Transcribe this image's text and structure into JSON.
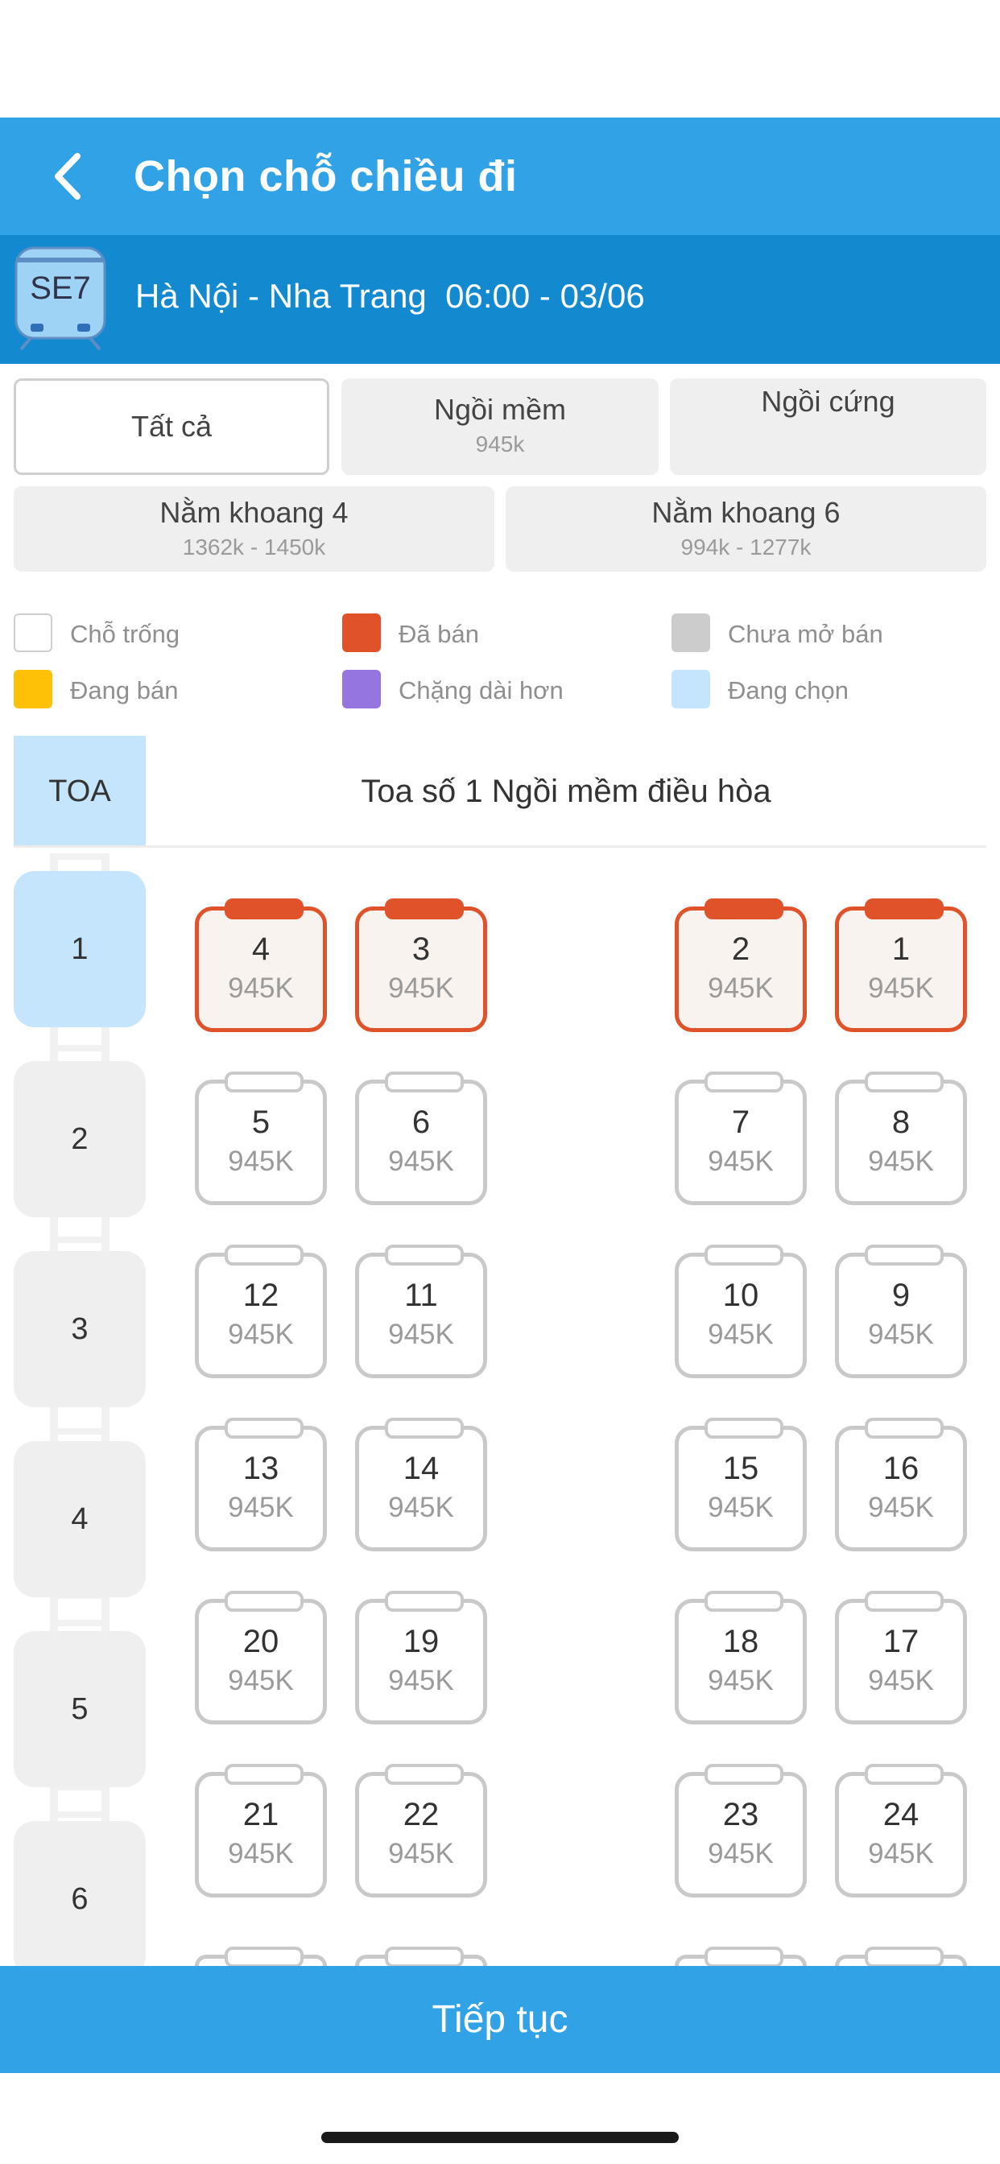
{
  "header": {
    "title": "Chọn chỗ chiều đi"
  },
  "train": {
    "code": "SE7",
    "route": "Hà Nội - Nha Trang  06:00 - 03/06"
  },
  "filters": [
    {
      "label": "Tất cả",
      "price": "",
      "active": true
    },
    {
      "label": "Ngồi mềm",
      "price": "945k",
      "active": false
    },
    {
      "label": "Ngồi cứng",
      "price": "",
      "active": false
    },
    {
      "label": "Nằm khoang 4",
      "price": "1362k - 1450k",
      "active": false
    },
    {
      "label": "Nằm khoang 6",
      "price": "994k - 1277k",
      "active": false
    }
  ],
  "legend": [
    {
      "label": "Chỗ trống",
      "color": "#ffffff"
    },
    {
      "label": "Đã bán",
      "color": "#e0532a"
    },
    {
      "label": "Chưa mở bán",
      "color": "#cccccc"
    },
    {
      "label": "Đang bán",
      "color": "#ffc107"
    },
    {
      "label": "Chặng dài hơn",
      "color": "#9575e0"
    },
    {
      "label": "Đang chọn",
      "color": "#c4e5fb"
    }
  ],
  "coach": {
    "toa_label": "TOA",
    "title": "Toa số 1  Ngồi mềm điều hòa"
  },
  "compartments": [
    "1",
    "2",
    "3",
    "4",
    "5",
    "6"
  ],
  "selected_compartment": "1",
  "seat_rows": [
    [
      {
        "num": "4",
        "price": "945K",
        "status": "sold"
      },
      {
        "num": "3",
        "price": "945K",
        "status": "sold"
      },
      {
        "num": "2",
        "price": "945K",
        "status": "sold"
      },
      {
        "num": "1",
        "price": "945K",
        "status": "sold"
      }
    ],
    [
      {
        "num": "5",
        "price": "945K",
        "status": "empty"
      },
      {
        "num": "6",
        "price": "945K",
        "status": "empty"
      },
      {
        "num": "7",
        "price": "945K",
        "status": "empty"
      },
      {
        "num": "8",
        "price": "945K",
        "status": "empty"
      }
    ],
    [
      {
        "num": "12",
        "price": "945K",
        "status": "empty"
      },
      {
        "num": "11",
        "price": "945K",
        "status": "empty"
      },
      {
        "num": "10",
        "price": "945K",
        "status": "empty"
      },
      {
        "num": "9",
        "price": "945K",
        "status": "empty"
      }
    ],
    [
      {
        "num": "13",
        "price": "945K",
        "status": "empty"
      },
      {
        "num": "14",
        "price": "945K",
        "status": "empty"
      },
      {
        "num": "15",
        "price": "945K",
        "status": "empty"
      },
      {
        "num": "16",
        "price": "945K",
        "status": "empty"
      }
    ],
    [
      {
        "num": "20",
        "price": "945K",
        "status": "empty"
      },
      {
        "num": "19",
        "price": "945K",
        "status": "empty"
      },
      {
        "num": "18",
        "price": "945K",
        "status": "empty"
      },
      {
        "num": "17",
        "price": "945K",
        "status": "empty"
      }
    ],
    [
      {
        "num": "21",
        "price": "945K",
        "status": "empty"
      },
      {
        "num": "22",
        "price": "945K",
        "status": "empty"
      },
      {
        "num": "23",
        "price": "945K",
        "status": "empty"
      },
      {
        "num": "24",
        "price": "945K",
        "status": "empty"
      }
    ]
  ],
  "continue_label": "Tiếp tục"
}
